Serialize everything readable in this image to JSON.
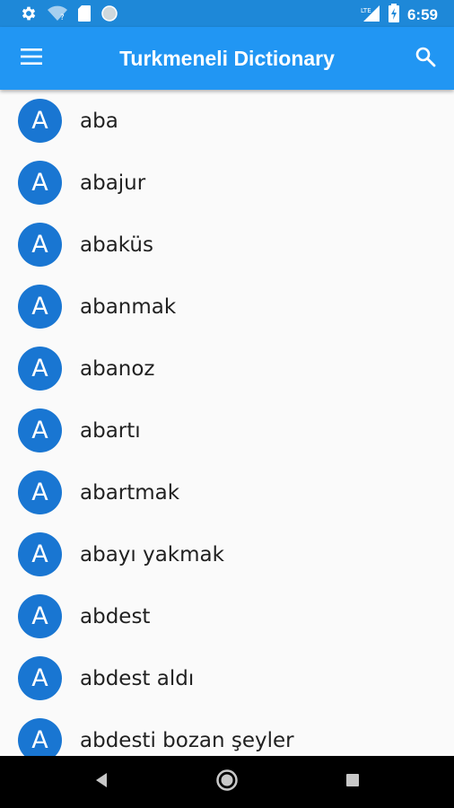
{
  "status_bar": {
    "time": "6:59",
    "icons": [
      "settings-icon",
      "wifi-question-icon",
      "sd-card-icon",
      "circle-icon",
      "lte-signal-icon",
      "battery-charging-icon"
    ]
  },
  "app_bar": {
    "title": "Turkmeneli Dictionary",
    "menu_icon": "hamburger-menu-icon",
    "search_icon": "search-icon",
    "background_color": "#2196f3"
  },
  "word_list": {
    "avatar_color": "#1976d2",
    "items": [
      {
        "letter": "A",
        "word": "aba"
      },
      {
        "letter": "A",
        "word": "abajur"
      },
      {
        "letter": "A",
        "word": "abaküs"
      },
      {
        "letter": "A",
        "word": "abanmak"
      },
      {
        "letter": "A",
        "word": "abanoz"
      },
      {
        "letter": "A",
        "word": "abartı"
      },
      {
        "letter": "A",
        "word": "abartmak"
      },
      {
        "letter": "A",
        "word": "abayı yakmak"
      },
      {
        "letter": "A",
        "word": "abdest"
      },
      {
        "letter": "A",
        "word": "abdest aldı"
      },
      {
        "letter": "A",
        "word": "abdesti bozan şeyler"
      }
    ]
  },
  "nav_bar": {
    "icons": [
      "back-icon",
      "home-icon",
      "recents-icon"
    ]
  }
}
